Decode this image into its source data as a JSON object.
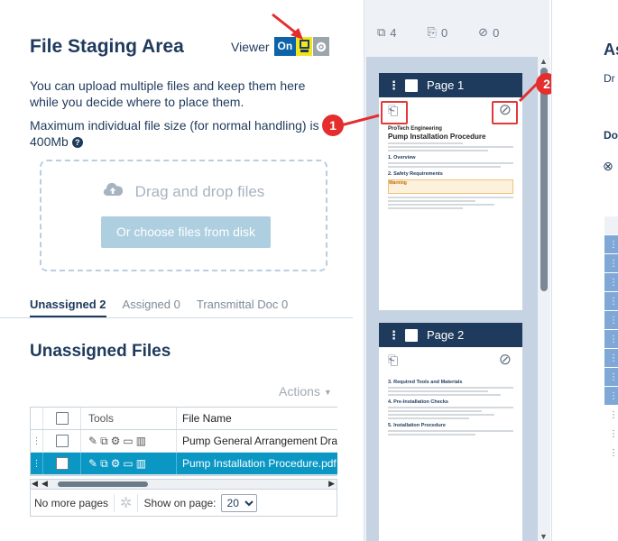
{
  "staging": {
    "title": "File Staging Area",
    "viewer_label": "Viewer",
    "viewer_state": "On",
    "description1": "You can upload multiple files and keep them here while you decide where to place them.",
    "description2": "Maximum individual file size (for normal handling) is 400Mb",
    "drag_text": "Drag and drop files",
    "choose_button": "Or choose files from disk",
    "tabs": [
      {
        "label": "Unassigned 2",
        "active": true
      },
      {
        "label": "Assigned 0",
        "active": false
      },
      {
        "label": "Transmittal Doc 0",
        "active": false
      }
    ],
    "list_title": "Unassigned Files",
    "actions_label": "Actions",
    "columns": {
      "tools": "Tools",
      "file_name": "File Name"
    },
    "files": [
      {
        "name": "Pump General Arrangement Drawir",
        "selected": false
      },
      {
        "name": "Pump Installation Procedure.pdf",
        "selected": true
      }
    ],
    "pager": {
      "no_more": "No more pages",
      "show_label": "Show on page:",
      "page_size": "20"
    }
  },
  "viewer_panel": {
    "counters": [
      {
        "icon": "copy-icon",
        "value": "4"
      },
      {
        "icon": "edit-doc-icon",
        "value": "0"
      },
      {
        "icon": "excluded-icon",
        "value": "0"
      }
    ],
    "pages": [
      {
        "label": "Page 1",
        "company": "ProTech Engineering",
        "doc_title": "Pump Installation Procedure",
        "sections": [
          "1. Overview",
          "2. Safety Requirements",
          "Warning"
        ]
      },
      {
        "label": "Page 2",
        "sections": [
          "3. Required Tools and Materials",
          "4. Pre-Installation Checks",
          "5. Installation Procedure"
        ]
      }
    ],
    "callouts": [
      "1",
      "2"
    ]
  },
  "right_panel": {
    "title": "As",
    "line1": "Dr",
    "line2": "Do"
  },
  "colors": {
    "navy": "#1e3a5c",
    "selected_row": "#0a97c4",
    "callout_red": "#e52d2d",
    "toggle_on": "#0c63a8",
    "viewer_highlight": "#f1e51d"
  }
}
